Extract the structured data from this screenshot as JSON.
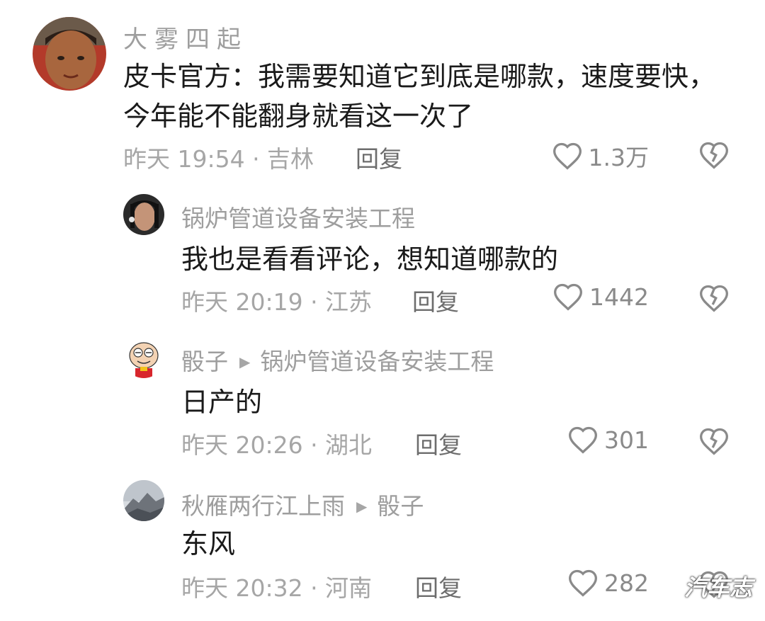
{
  "comments": [
    {
      "username": "大雾四起",
      "text": "皮卡官方：我需要知道它到底是哪款，速度要快，今年能不能翻身就看这一次了",
      "meta": "昨天 19:54 · 吉林",
      "reply_label": "回复",
      "likes": "1.3万"
    },
    {
      "username": "锅炉管道设备安装工程",
      "text": "我也是看看评论，想知道哪款的",
      "meta": "昨天 20:19 · 江苏",
      "reply_label": "回复",
      "likes": "1442"
    },
    {
      "username": "骰子",
      "reply_to": "锅炉管道设备安装工程",
      "text": "日产的",
      "meta": "昨天 20:26 · 湖北",
      "reply_label": "回复",
      "likes": "301"
    },
    {
      "username": "秋雁两行江上雨",
      "reply_to": "骰子",
      "text": "东风",
      "meta": "昨天 20:32 · 河南",
      "reply_label": "回复",
      "likes": "282"
    }
  ],
  "watermark": "汽车志",
  "icons": {
    "like": "heart-outline-icon",
    "dislike": "broken-heart-icon",
    "reply_arrow": "triangle-right-icon"
  },
  "colors": {
    "username": "#9e9e9e",
    "text": "#1a1a1a",
    "meta": "#a6a6a6"
  }
}
